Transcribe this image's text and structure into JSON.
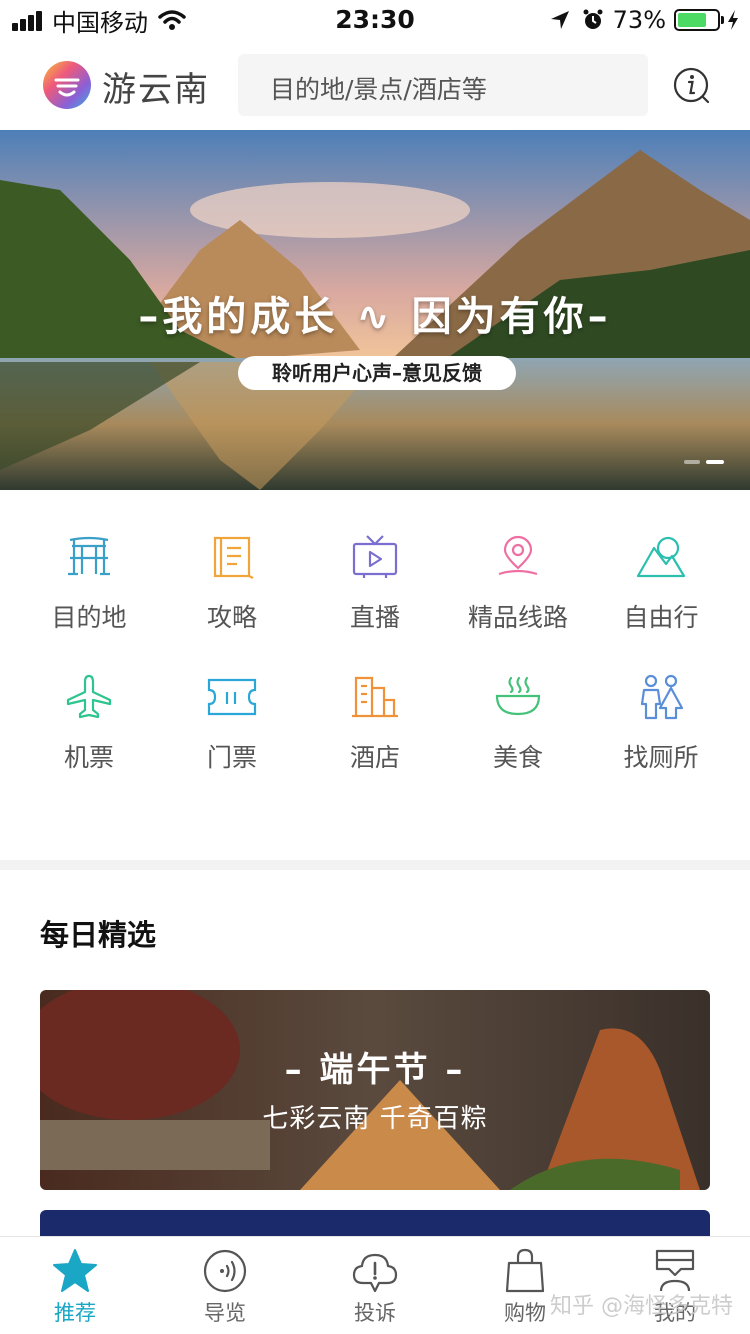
{
  "status_bar": {
    "carrier": "中国移动",
    "time": "23:30",
    "battery_percent": "73%",
    "battery_level": 0.73
  },
  "header": {
    "brand": "游云南",
    "search_placeholder": "目的地/景点/酒店等"
  },
  "banner": {
    "title": "–我的成长 ∿ 因为有你–",
    "subtitle": "聆听用户心声–意见反馈"
  },
  "categories": [
    {
      "label": "目的地",
      "icon": "gate-icon",
      "color": "#3aa0c8"
    },
    {
      "label": "攻略",
      "icon": "book-icon",
      "color": "#f0a43a"
    },
    {
      "label": "直播",
      "icon": "tv-icon",
      "color": "#7a6fd0"
    },
    {
      "label": "精品线路",
      "icon": "map-pin-icon",
      "color": "#ef6fa3"
    },
    {
      "label": "自由行",
      "icon": "mountain-icon",
      "color": "#2bbfb0"
    },
    {
      "label": "机票",
      "icon": "plane-icon",
      "color": "#2cc48f"
    },
    {
      "label": "门票",
      "icon": "ticket-icon",
      "color": "#2aa6d8"
    },
    {
      "label": "酒店",
      "icon": "hotel-icon",
      "color": "#f0923a"
    },
    {
      "label": "美食",
      "icon": "bowl-icon",
      "color": "#45c27a"
    },
    {
      "label": "找厕所",
      "icon": "restroom-icon",
      "color": "#5a8ed8"
    }
  ],
  "daily": {
    "title": "每日精选",
    "card_title": "– 端午节 –",
    "card_subtitle": "七彩云南  千奇百粽"
  },
  "tabs": [
    {
      "label": "推荐",
      "icon": "star-icon",
      "active": true
    },
    {
      "label": "导览",
      "icon": "audio-guide-icon",
      "active": false
    },
    {
      "label": "投诉",
      "icon": "complaint-cloud-icon",
      "active": false
    },
    {
      "label": "购物",
      "icon": "shopping-bag-icon",
      "active": false
    },
    {
      "label": "我的",
      "icon": "profile-icon",
      "active": false
    }
  ],
  "watermark": "知乎 @海怪多克特",
  "colors": {
    "accent": "#1aa7c6",
    "battery": "#4cd964"
  }
}
